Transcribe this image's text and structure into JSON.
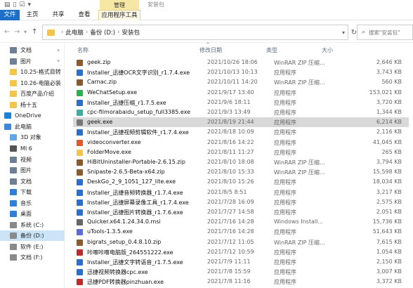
{
  "titlebar": {
    "qat_icons": [
      "save-icon",
      "document-icon",
      "checkbox-icon",
      "dropdown-icon"
    ],
    "tool_header": "管理",
    "title": "安装包"
  },
  "ribbon": {
    "tabs": [
      "文件",
      "主页",
      "共享",
      "查看",
      "应用程序工具"
    ],
    "accent": "#1e6fc8",
    "context_color": "#f6e7a5"
  },
  "address": {
    "parts": [
      "此电脑",
      "备份 (D:)",
      "安装包"
    ],
    "search_placeholder": "搜索\"安装包\""
  },
  "nav": {
    "items": [
      {
        "label": "文档",
        "icon": "document-icon",
        "color": "#6f7f95",
        "pin": true
      },
      {
        "label": "图片",
        "icon": "pictures-icon",
        "color": "#6f7f95",
        "pin": true
      },
      {
        "label": "10.25-格式目转",
        "icon": "folder-icon",
        "color": "#f3c64a",
        "pin": false
      },
      {
        "label": "10.26-电脑必装",
        "icon": "folder-icon",
        "color": "#f3c64a",
        "pin": false
      },
      {
        "label": "百度产品介绍",
        "icon": "folder-icon",
        "color": "#f3c64a",
        "pin": false
      },
      {
        "label": "杨十五",
        "icon": "folder-icon",
        "color": "#f3c64a",
        "pin": false
      },
      {
        "label": "OneDrive",
        "icon": "cloud-icon",
        "color": "#1c82d4",
        "pin": false
      },
      {
        "label": "此电脑",
        "icon": "computer-icon",
        "color": "#3d86d8",
        "pin": false
      },
      {
        "label": "3D 对象",
        "icon": "3d-objects-icon",
        "color": "#5fa9e8",
        "pin": false
      },
      {
        "label": "MI 6",
        "icon": "phone-icon",
        "color": "#555555",
        "pin": false
      },
      {
        "label": "视频",
        "icon": "video-icon",
        "color": "#6f7f95",
        "pin": false
      },
      {
        "label": "图片",
        "icon": "pictures-icon",
        "color": "#6f7f95",
        "pin": false
      },
      {
        "label": "文档",
        "icon": "document-icon",
        "color": "#6f7f95",
        "pin": false
      },
      {
        "label": "下载",
        "icon": "download-icon",
        "color": "#2f7fd6",
        "pin": false
      },
      {
        "label": "音乐",
        "icon": "music-icon",
        "color": "#2f7fd6",
        "pin": false
      },
      {
        "label": "桌面",
        "icon": "desktop-icon",
        "color": "#2f7fd6",
        "pin": false
      },
      {
        "label": "系统 (C:)",
        "icon": "drive-icon",
        "color": "#8a8a8a",
        "pin": false
      },
      {
        "label": "备份 (D:)",
        "icon": "drive-icon",
        "color": "#8a8a8a",
        "pin": false,
        "selected": true
      },
      {
        "label": "软件 (E:)",
        "icon": "drive-icon",
        "color": "#8a8a8a",
        "pin": false
      },
      {
        "label": "文档 (F:)",
        "icon": "drive-icon",
        "color": "#8a8a8a",
        "pin": false
      }
    ]
  },
  "columns": {
    "name": "名称",
    "date": "修改日期",
    "type": "类型",
    "size": "大小"
  },
  "files": [
    {
      "name": "geek.zip",
      "date": "2021/10/26 18:06",
      "type": "WinRAR ZIP 压缩...",
      "size": "2,646 KB",
      "color": "#8a5a2c"
    },
    {
      "name": "Installer_迅捷OCR文字识别_r1.7.4.exe",
      "date": "2021/10/13 10:13",
      "type": "应用程序",
      "size": "3,743 KB",
      "color": "#2a6fd0"
    },
    {
      "name": "Carnac.zip",
      "date": "2021/10/11 14:20",
      "type": "WinRAR ZIP 压缩...",
      "size": "560 KB",
      "color": "#8a5a2c"
    },
    {
      "name": "WeChatSetup.exe",
      "date": "2021/9/17 13:40",
      "type": "应用程序",
      "size": "153,021 KB",
      "color": "#2bb24c"
    },
    {
      "name": "Installer_迅捷压缩_r1.7.5.exe",
      "date": "2021/9/6 18:11",
      "type": "应用程序",
      "size": "3,720 KB",
      "color": "#2a6fd0"
    },
    {
      "name": "cpc-filmorabaidu_setup_full3385.exe",
      "date": "2021/9/3 13:49",
      "type": "应用程序",
      "size": "1,344 KB",
      "color": "#3ab0a0"
    },
    {
      "name": "geek.exe",
      "date": "2021/8/19 21:44",
      "type": "应用程序",
      "size": "6,214 KB",
      "color": "#777777",
      "selected": true
    },
    {
      "name": "Installer_迅捷视频剪辑软件_r1.7.4.exe",
      "date": "2021/8/18 10:09",
      "type": "应用程序",
      "size": "2,116 KB",
      "color": "#2a6fd0"
    },
    {
      "name": "videoconverter.exe",
      "date": "2021/8/16 14:22",
      "type": "应用程序",
      "size": "41,045 KB",
      "color": "#e05a2a"
    },
    {
      "name": "FolderMove.exe",
      "date": "2021/8/11 11:27",
      "type": "应用程序",
      "size": "265 KB",
      "color": "#f3c64a"
    },
    {
      "name": "HiBitUninstaller-Portable-2.6.15.zip",
      "date": "2021/8/10 18:08",
      "type": "WinRAR ZIP 压缩...",
      "size": "3,794 KB",
      "color": "#8a5a2c"
    },
    {
      "name": "Snipaste-2.6.5-Beta-x64.zip",
      "date": "2021/8/10 15:33",
      "type": "WinRAR ZIP 压缩...",
      "size": "15,598 KB",
      "color": "#8a5a2c"
    },
    {
      "name": "DeskGo_2_9_1051_127_lite.exe",
      "date": "2021/8/10 15:26",
      "type": "应用程序",
      "size": "18,034 KB",
      "color": "#2a6fd0"
    },
    {
      "name": "Installer_迅捷音频转换器_r1.7.4.exe",
      "date": "2021/8/5 8:51",
      "type": "应用程序",
      "size": "3,217 KB",
      "color": "#2a6fd0"
    },
    {
      "name": "Installer_迅捷屏幕录像工具_r1.7.4.exe",
      "date": "2021/7/28 16:09",
      "type": "应用程序",
      "size": "2,575 KB",
      "color": "#2a6fd0"
    },
    {
      "name": "Installer_迅捷图片转换器_r1.7.6.exe",
      "date": "2021/7/27 14:58",
      "type": "应用程序",
      "size": "2,051 KB",
      "color": "#2a6fd0"
    },
    {
      "name": "Quicker.x64.1.24.34.0.msi",
      "date": "2021/7/16 14:28",
      "type": "Windows Install...",
      "size": "15,736 KB",
      "color": "#666666"
    },
    {
      "name": "uTools-1.3.5.exe",
      "date": "2021/7/16 14:28",
      "type": "应用程序",
      "size": "51,643 KB",
      "color": "#5b6cd6"
    },
    {
      "name": "bigrats_setup_0.4.8.10.zip",
      "date": "2021/7/12 11:05",
      "type": "WinRAR ZIP 压缩...",
      "size": "7,615 KB",
      "color": "#8a5a2c"
    },
    {
      "name": "咔嚓咔嚓电脑版_264551222.exe",
      "date": "2021/7/12 10:59",
      "type": "应用程序",
      "size": "1,054 KB",
      "color": "#c02a2a"
    },
    {
      "name": "Installer_迅捷文字转语音_r1.7.5.exe",
      "date": "2021/7/9 11:11",
      "type": "应用程序",
      "size": "2,150 KB",
      "color": "#2a6fd0"
    },
    {
      "name": "迅捷视频转换器cpc.exe",
      "date": "2021/7/8 15:59",
      "type": "应用程序",
      "size": "3,007 KB",
      "color": "#2a6fd0"
    },
    {
      "name": "迅捷PDF转换器pinzhuan.exe",
      "date": "2021/7/8 11:16",
      "type": "应用程序",
      "size": "3,372 KB",
      "color": "#c02a2a"
    }
  ]
}
